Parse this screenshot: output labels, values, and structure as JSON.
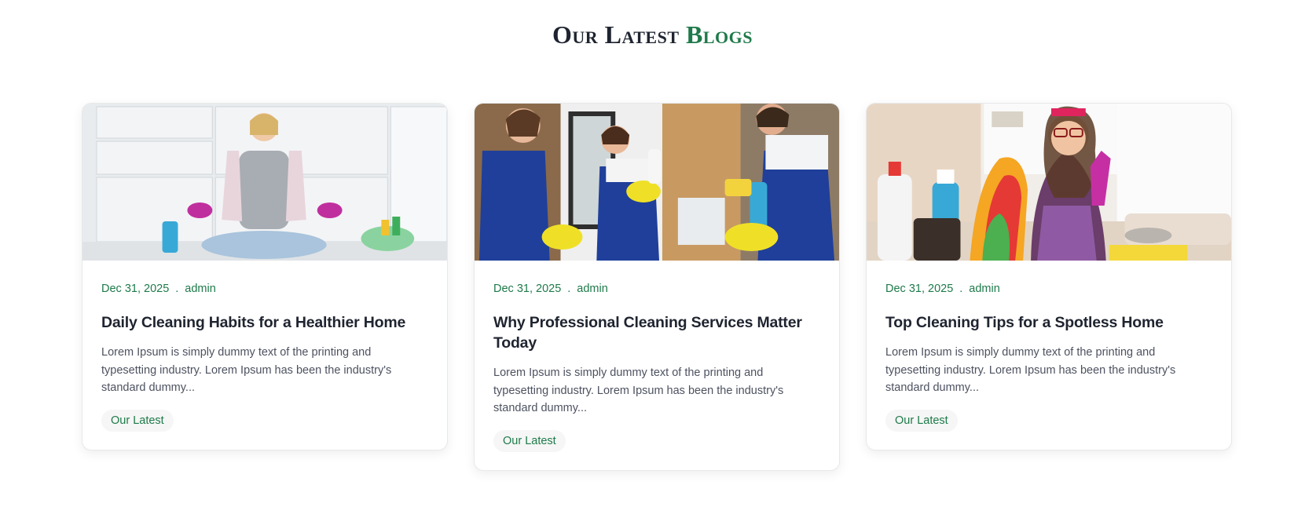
{
  "section": {
    "title_part1": "Our Latest",
    "title_part2": "Blogs"
  },
  "posts": [
    {
      "date": "Dec 31, 2025",
      "separator": ".",
      "author": "admin",
      "title": "Daily Cleaning Habits for a Healthier Home",
      "excerpt": "Lorem Ipsum is simply dummy text of the printing and typesetting industry. Lorem Ipsum has been the industry's standard dummy...",
      "cta": "Our Latest"
    },
    {
      "date": "Dec 31, 2025",
      "separator": ".",
      "author": "admin",
      "title": "Why Professional Cleaning Services Matter Today",
      "excerpt": "Lorem Ipsum is simply dummy text of the printing and typesetting industry. Lorem Ipsum has been the industry's standard dummy...",
      "cta": "Our Latest"
    },
    {
      "date": "Dec 31, 2025",
      "separator": ".",
      "author": "admin",
      "title": "Top Cleaning Tips for a Spotless Home",
      "excerpt": "Lorem Ipsum is simply dummy text of the printing and typesetting industry. Lorem Ipsum has been the industry's standard dummy...",
      "cta": "Our Latest"
    }
  ],
  "colors": {
    "accent": "#1e7a4a",
    "heading": "#1f2430",
    "body_text": "#4d5260"
  }
}
